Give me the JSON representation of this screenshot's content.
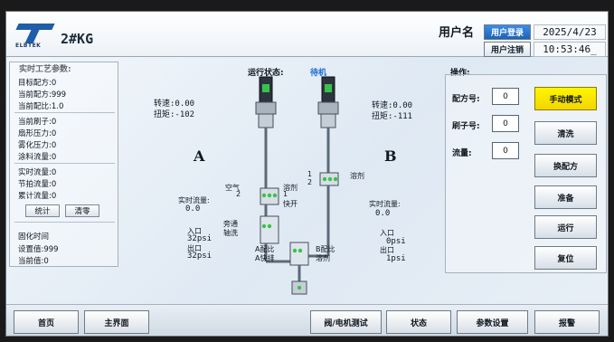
{
  "header": {
    "logo_text": "ELBTEK",
    "machine_name": "2#KG",
    "user_label": "用户名",
    "login_button": "用户登录",
    "logout_button": "用户注销",
    "date": "2025/4/23",
    "time": "10:53:46_"
  },
  "process": {
    "title": "实时工艺参数:",
    "group1": [
      "目标配方:0",
      "当前配方:999",
      "当前配比:1.0"
    ],
    "group2": [
      "当前刷子:0",
      "扇形压力:0",
      "雾化压力:0",
      "涂料流量:0"
    ],
    "group3": [
      "实时流量:0",
      "节拍流量:0",
      "累计流量:0"
    ],
    "stats_button": "统计",
    "clear_button": "清零",
    "cure_title": "固化时间",
    "cure_set": "设置值:999",
    "cure_current": "当前值:0"
  },
  "diagram": {
    "run_state_label": "运行状态:",
    "run_state_value": "待机",
    "a": {
      "letter": "A",
      "speed": "转速:0.00",
      "torque": "扭矩:-102",
      "flow_label": "实时流量:",
      "flow_value": "0.0",
      "inlet_label": "入口",
      "inlet_value": "32psi",
      "outlet_label": "出口",
      "outlet_value": "32psi"
    },
    "b": {
      "letter": "B",
      "speed": "转速:0.00",
      "torque": "扭矩:-111",
      "flow_label": "实时流量:",
      "flow_value": "0.0",
      "inlet_label": "入口",
      "inlet_value": "0psi",
      "outlet_label": "出口",
      "outlet_value": "1psi"
    },
    "labels": {
      "air": "空气",
      "two_a": "2",
      "solvent_a": "溶剂",
      "one_a": "1",
      "quick_open": "快开",
      "one_b": "1",
      "two_b": "2",
      "solvent_b": "溶剂",
      "bypass": "旁通",
      "shaft_wash": "轴洗",
      "a_ratio": "A配比",
      "a_quick": "A快排",
      "b_ratio": "B配比",
      "solvent_mix": "溶剂"
    }
  },
  "operation": {
    "title": "操作:",
    "recipe_label": "配方号:",
    "recipe_value": "0",
    "brush_label": "刷子号:",
    "brush_value": "0",
    "flow_label": "流量:",
    "flow_value": "0",
    "buttons": [
      "手动模式",
      "清洗",
      "换配方",
      "准备",
      "运行",
      "复位"
    ]
  },
  "nav": [
    "首页",
    "主界面",
    "阀/电机测试",
    "状态",
    "参数设置",
    "报警"
  ],
  "colors": {
    "accent_blue": "#1a6ad6",
    "highlight_yellow": "#fff600",
    "motor_green": "#39c24a"
  }
}
